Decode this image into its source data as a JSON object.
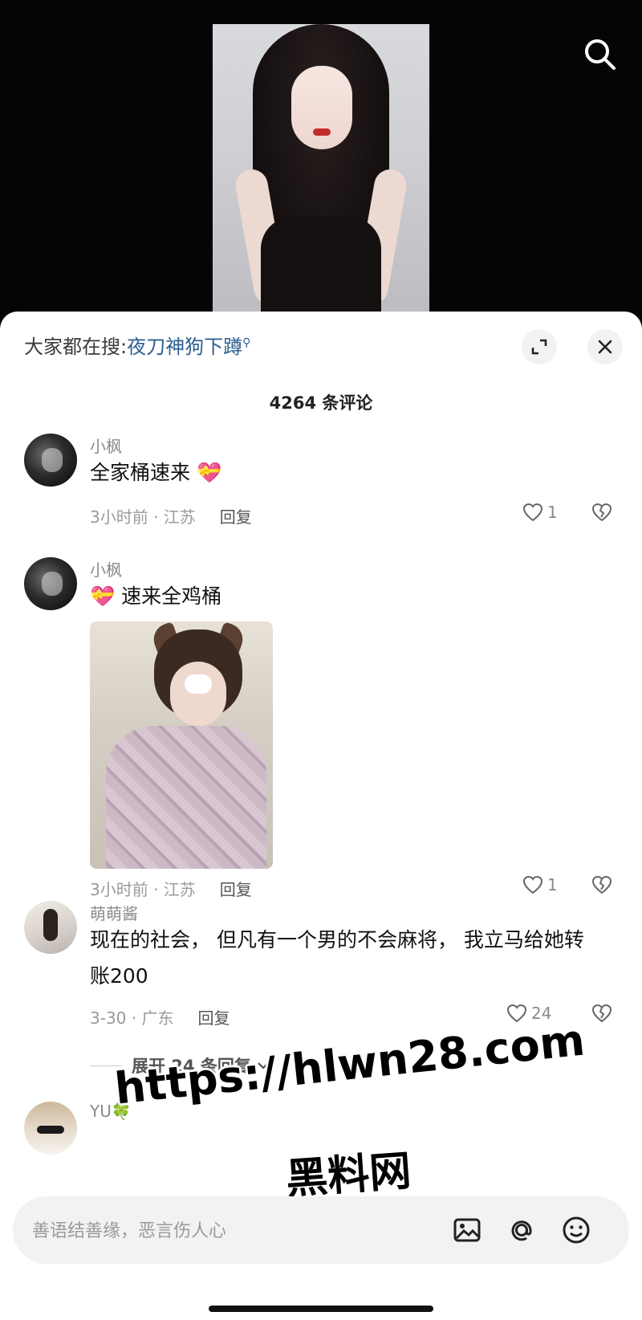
{
  "hot_search": {
    "label": "大家都在搜:",
    "term": "夜刀神狗下蹲"
  },
  "comment_count": "4264 条评论",
  "comments": [
    {
      "username": "小枫",
      "text": "全家桶速来",
      "emoji": "💝",
      "time": "3小时前 · 江苏",
      "reply": "回复",
      "likes": "1"
    },
    {
      "username": "小枫",
      "text": "速来全鸡桶",
      "emoji": "💝",
      "time": "3小时前 · 江苏",
      "reply": "回复",
      "likes": "1"
    },
    {
      "username": "萌萌酱",
      "text": "现在的社会， 但凡有一个男的不会麻将， 我立马给她转账200",
      "time": "3-30 · 广东",
      "reply": "回复",
      "likes": "24",
      "expand_replies": "展开 24 条回复"
    },
    {
      "username": "YU",
      "emoji": "🍀"
    }
  ],
  "watermark": {
    "url": "https://hlwn28.com",
    "name": "黑料网"
  },
  "input": {
    "placeholder": "善语结善缘，恶言伤人心"
  },
  "icons": {
    "search": "search-icon",
    "expand": "expand-icon",
    "close": "close-icon",
    "like": "heart-icon",
    "dislike": "broken-heart-icon",
    "image": "image-icon",
    "at": "at-icon",
    "emoji": "emoji-icon"
  },
  "colors": {
    "sheet_bg": "#ffffff",
    "hot_term": "#2c5f8f",
    "video_bg": "#050505"
  }
}
